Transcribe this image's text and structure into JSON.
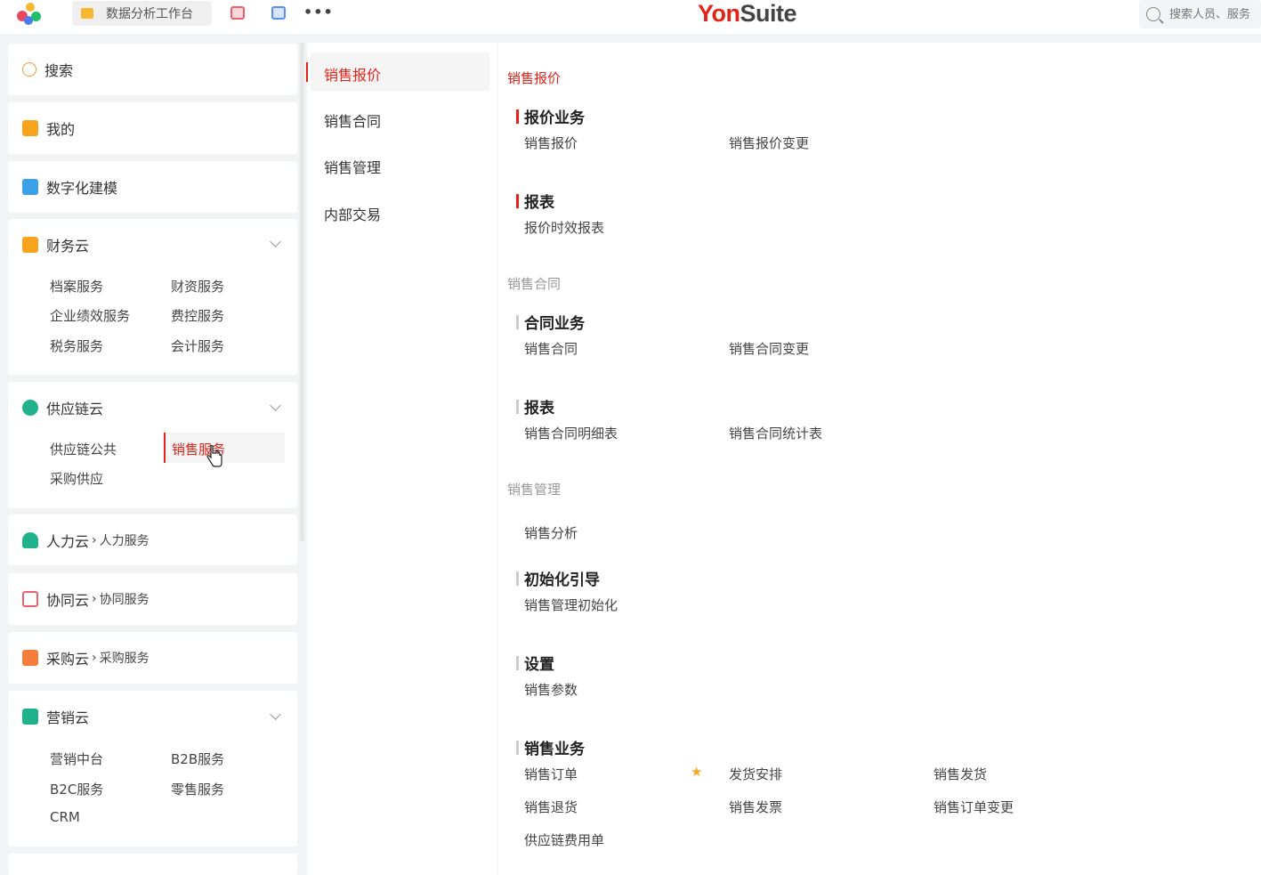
{
  "topbar": {
    "tab_label": "数据分析工作台",
    "more": "•••",
    "brand_yon": "Yon",
    "brand_suite": "Suite",
    "search_placeholder": "搜索人员、服务"
  },
  "sidebar": {
    "search": "搜索",
    "mine": "我的",
    "modeling": "数字化建模",
    "finance": {
      "title": "财务云",
      "items": [
        "档案服务",
        "财资服务",
        "企业绩效服务",
        "费控服务",
        "税务服务",
        "会计服务"
      ]
    },
    "supply": {
      "title": "供应链云",
      "items": [
        "供应链公共",
        "销售服务",
        "采购供应"
      ]
    },
    "hr": {
      "title": "人力云",
      "sub": "人力服务"
    },
    "collab": {
      "title": "协同云",
      "sub": "协同服务"
    },
    "purchase": {
      "title": "采购云",
      "sub": "采购服务"
    },
    "marketing": {
      "title": "营销云",
      "items": [
        "营销中台",
        "B2B服务",
        "B2C服务",
        "零售服务",
        "CRM"
      ]
    }
  },
  "middle": {
    "items": [
      "销售报价",
      "销售合同",
      "销售管理",
      "内部交易"
    ]
  },
  "content": {
    "sections": [
      {
        "title": "销售报价"
      },
      {
        "title": "销售合同"
      },
      {
        "title": "销售管理"
      }
    ],
    "groups": {
      "quote_biz": {
        "title": "报价业务",
        "links": [
          "销售报价",
          "销售报价变更"
        ]
      },
      "quote_report": {
        "title": "报表",
        "links": [
          "报价时效报表"
        ]
      },
      "contract_biz": {
        "title": "合同业务",
        "links": [
          "销售合同",
          "销售合同变更"
        ]
      },
      "contract_report": {
        "title": "报表",
        "links": [
          "销售合同明细表",
          "销售合同统计表"
        ]
      },
      "mgmt_analysis": {
        "links": [
          "销售分析"
        ]
      },
      "init": {
        "title": "初始化引导",
        "links": [
          "销售管理初始化"
        ]
      },
      "settings": {
        "title": "设置",
        "links": [
          "销售参数"
        ]
      },
      "sales_biz": {
        "title": "销售业务",
        "links": [
          "销售订单",
          "发货安排",
          "销售发货",
          "销售退货",
          "销售发票",
          "销售订单变更",
          "供应链费用单"
        ]
      }
    }
  },
  "colors": {
    "accent": "#e2231a",
    "star": "#f5a623"
  }
}
